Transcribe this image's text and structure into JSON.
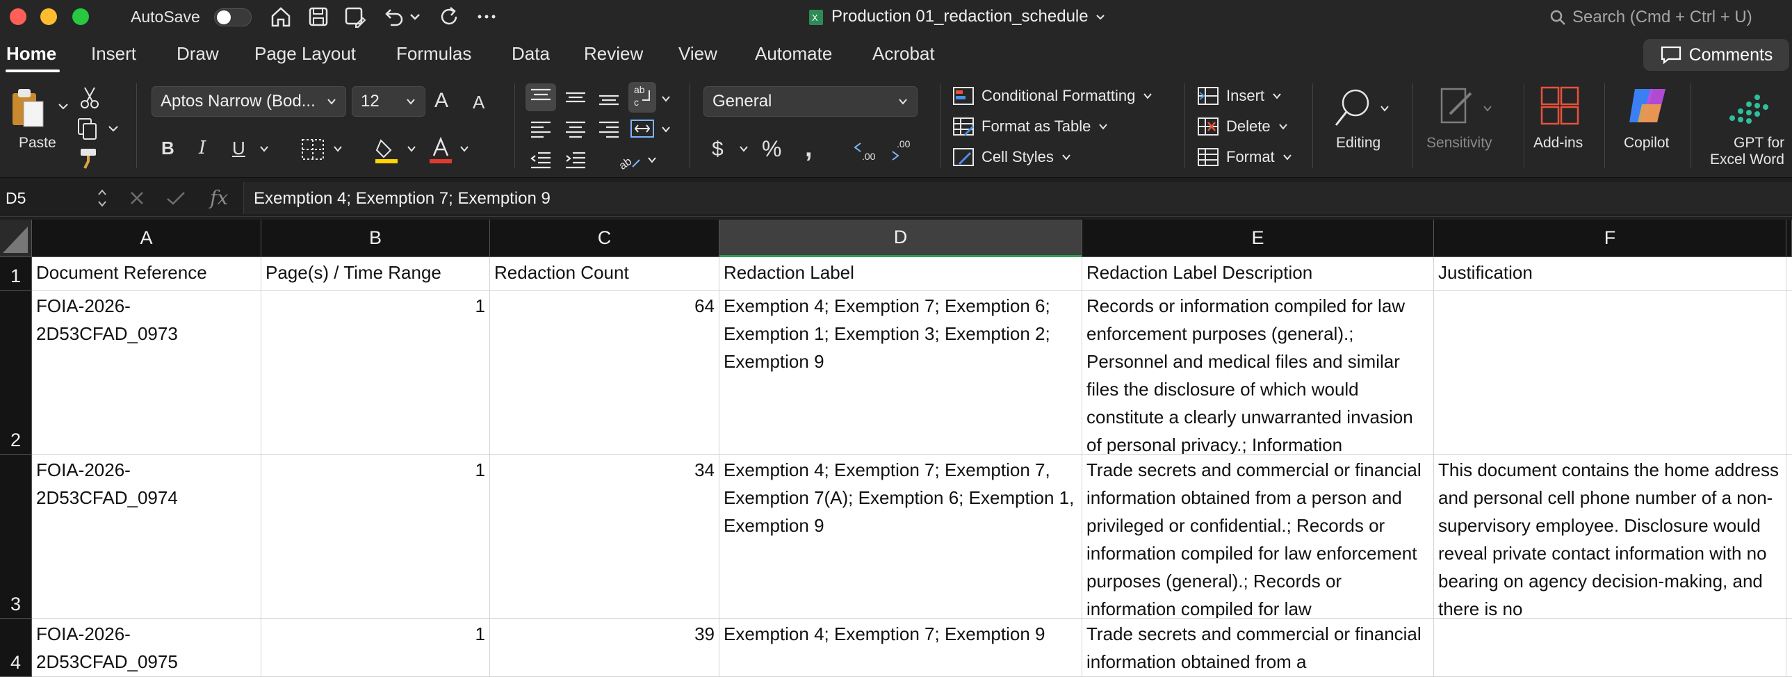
{
  "titlebar": {
    "autosave_label": "AutoSave",
    "document_title": "Production 01_redaction_schedule",
    "search_placeholder": "Search (Cmd + Ctrl + U)"
  },
  "menu": {
    "tabs": [
      "Home",
      "Insert",
      "Draw",
      "Page Layout",
      "Formulas",
      "Data",
      "Review",
      "View",
      "Automate",
      "Acrobat"
    ],
    "active_tab": "Home",
    "comments_label": "Comments"
  },
  "ribbon": {
    "paste_label": "Paste",
    "font_name": "Aptos Narrow (Bod...",
    "font_size": "12",
    "number_format": "General",
    "conditional_formatting": "Conditional Formatting",
    "format_as_table": "Format as Table",
    "cell_styles": "Cell Styles",
    "insert_label": "Insert",
    "delete_label": "Delete",
    "format_label": "Format",
    "editing_label": "Editing",
    "sensitivity_label": "Sensitivity",
    "addins_label": "Add-ins",
    "copilot_label": "Copilot",
    "gpt_label_1": "GPT for",
    "gpt_label_2": "Excel Word",
    "bold": "B",
    "italic": "I",
    "underline": "U",
    "percent": "%",
    "currency": "$",
    "comma": ",",
    "increase_decimal": ".00",
    "decrease_decimal": ".00",
    "font_grow": "A",
    "font_shrink": "A"
  },
  "formula_bar": {
    "name_box": "D5",
    "fx_label": "fx",
    "formula": "Exemption 4; Exemption 7; Exemption 9"
  },
  "sheet": {
    "columns": [
      "A",
      "B",
      "C",
      "D",
      "E",
      "F"
    ],
    "selected_column": "D",
    "row_numbers": [
      "1",
      "2",
      "3",
      "4"
    ],
    "header_row": [
      "Document Reference",
      "Page(s) / Time Range",
      "Redaction Count",
      "Redaction Label",
      "Redaction Label Description",
      "Justification"
    ],
    "rows": [
      [
        "FOIA-2026-2D53CFAD_0973",
        "1",
        "64",
        "Exemption 4; Exemption 7; Exemption 6; Exemption 1; Exemption 3; Exemption 2; Exemption 9",
        "Records or information compiled for law enforcement purposes (general).; Personnel and medical files and similar files the disclosure of which would constitute a clearly unwarranted invasion of personal privacy.; Information",
        ""
      ],
      [
        "FOIA-2026-2D53CFAD_0974",
        "1",
        "34",
        "Exemption 4; Exemption 7; Exemption 7, Exemption 7(A); Exemption 6; Exemption 1, Exemption 9",
        "Trade secrets and commercial or financial information obtained from a person and privileged or confidential.; Records or information compiled for law enforcement purposes (general).; Records or information compiled for law",
        "This document contains the home address and personal cell phone number of a non-supervisory employee. Disclosure would reveal private contact information with no bearing on agency decision-making, and there is no"
      ],
      [
        "FOIA-2026-2D53CFAD_0975",
        "1",
        "39",
        "Exemption 4; Exemption 7; Exemption 9",
        "Trade secrets and commercial or financial information obtained from a",
        ""
      ]
    ]
  }
}
